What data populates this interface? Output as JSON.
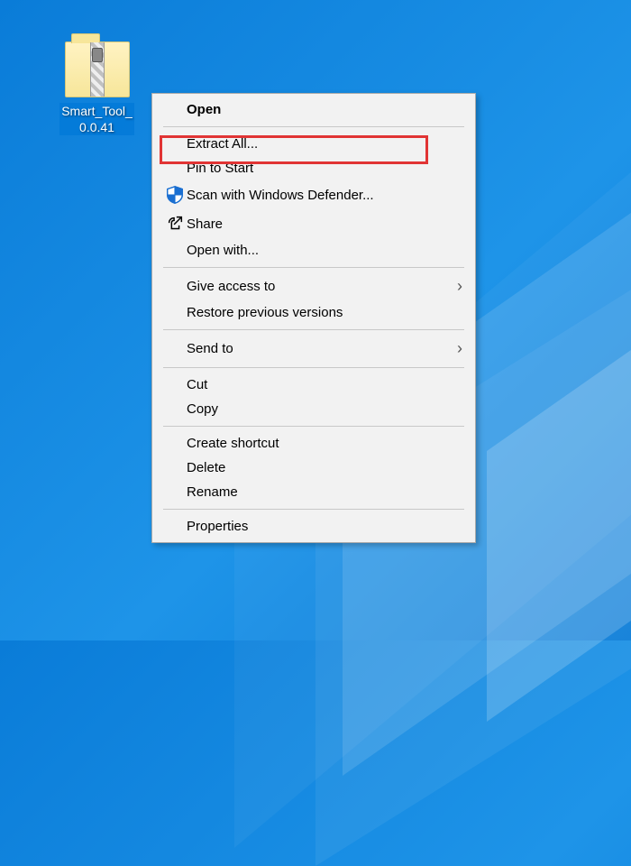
{
  "desktop_icon": {
    "label_line1": "Smart_Tool_",
    "label_line2": "0.0.41"
  },
  "context_menu": {
    "open": "Open",
    "extract_all": "Extract All...",
    "pin_to_start": "Pin to Start",
    "scan_defender": "Scan with Windows Defender...",
    "share": "Share",
    "open_with": "Open with...",
    "give_access_to": "Give access to",
    "restore_previous": "Restore previous versions",
    "send_to": "Send to",
    "cut": "Cut",
    "copy": "Copy",
    "create_shortcut": "Create shortcut",
    "delete": "Delete",
    "rename": "Rename",
    "properties": "Properties"
  }
}
